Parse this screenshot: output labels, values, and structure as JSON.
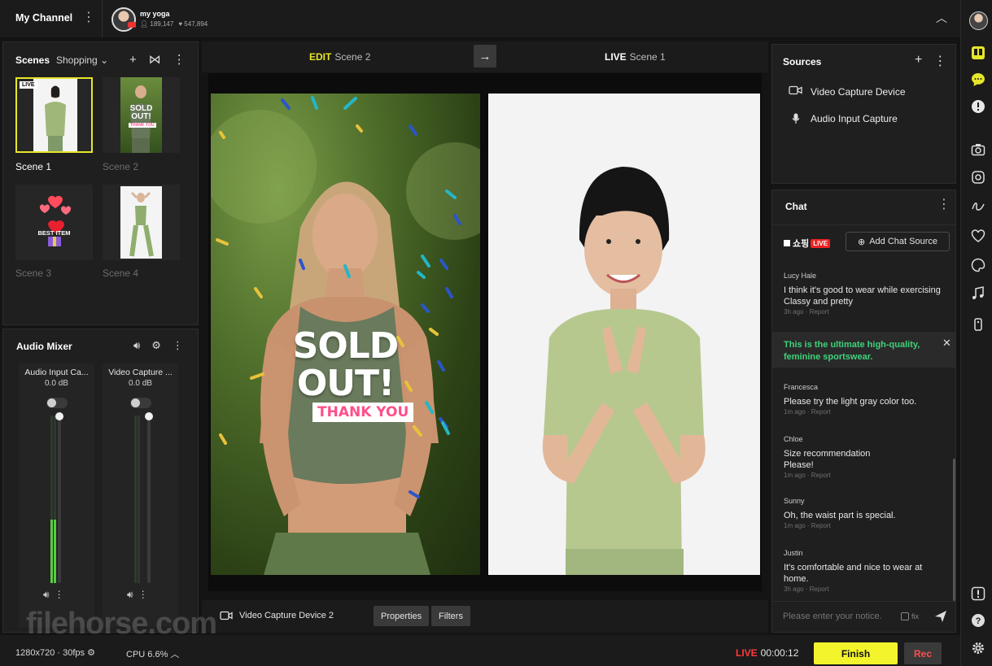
{
  "header": {
    "channel_title": "My Channel",
    "profile_name": "my yoga",
    "followers": "189,147",
    "likes": "547,894"
  },
  "scenes": {
    "title": "Scenes",
    "group": "Shopping",
    "live_badge": "LIVE",
    "items": [
      {
        "label": "Scene 1"
      },
      {
        "label": "Scene 2"
      },
      {
        "label": "Scene 3"
      },
      {
        "label": "Scene 4"
      }
    ],
    "scene2_overlay_line1": "SOLD",
    "scene2_overlay_line2": "OUT!",
    "scene2_overlay_line3": "THANK YOU",
    "scene3_overlay": "BEST ITEM"
  },
  "mixer": {
    "title": "Audio Mixer",
    "channels": [
      {
        "name": "Audio Input Ca...",
        "db": "0.0 dB",
        "level": 0.38
      },
      {
        "name": "Video Capture ...",
        "db": "0.0 dB",
        "level": 0.0
      }
    ]
  },
  "center": {
    "edit_mode": "EDIT",
    "edit_scene": "Scene 2",
    "live_mode": "LIVE",
    "live_scene": "Scene 1",
    "overlay_line1": "SOLD",
    "overlay_line2": "OUT!",
    "overlay_line3": "THANK YOU",
    "source_name": "Video Capture Device 2",
    "properties_btn": "Properties",
    "filters_btn": "Filters"
  },
  "sources": {
    "title": "Sources",
    "items": [
      {
        "label": "Video Capture Device",
        "icon": "camera-icon"
      },
      {
        "label": "Audio Input Capture",
        "icon": "microphone-icon"
      }
    ]
  },
  "chat": {
    "title": "Chat",
    "shop_brand": "쇼핑",
    "shop_live": "LIVE",
    "add_source": "Add Chat Source",
    "report": "Report",
    "messages": [
      {
        "user": "Lucy Hale",
        "text": "I think it's good to wear while exercising Classy and pretty",
        "time": "3h ago"
      },
      {
        "user": "Francesca",
        "text": "Please try the light gray color too.",
        "time": "1m ago"
      },
      {
        "user": "Chloe",
        "text": "Size recommendation Please!",
        "time": "1m ago"
      },
      {
        "user": "Sunny",
        "text": "Oh, the waist part is special.",
        "time": "1m ago"
      },
      {
        "user": "Justin",
        "text": "It's comfortable and nice to wear at home.",
        "time": "3h ago"
      }
    ],
    "pinned": "This is the ultimate high-quality, feminine sportswear.",
    "input_placeholder": "Please enter your notice.",
    "fix_label": "fix"
  },
  "status": {
    "resolution": "1280x720 · 30fps",
    "cpu": "CPU 6.6%",
    "live_label": "LIVE",
    "timer": "00:00:12",
    "finish": "Finish",
    "rec": "Rec",
    "watermark": "filehorse.com"
  },
  "colors": {
    "accent_yellow": "#f4f42c",
    "live_red": "#ff3b3b",
    "pinned_green": "#3fd27a",
    "thank_you_pink": "#ff4f8b"
  }
}
